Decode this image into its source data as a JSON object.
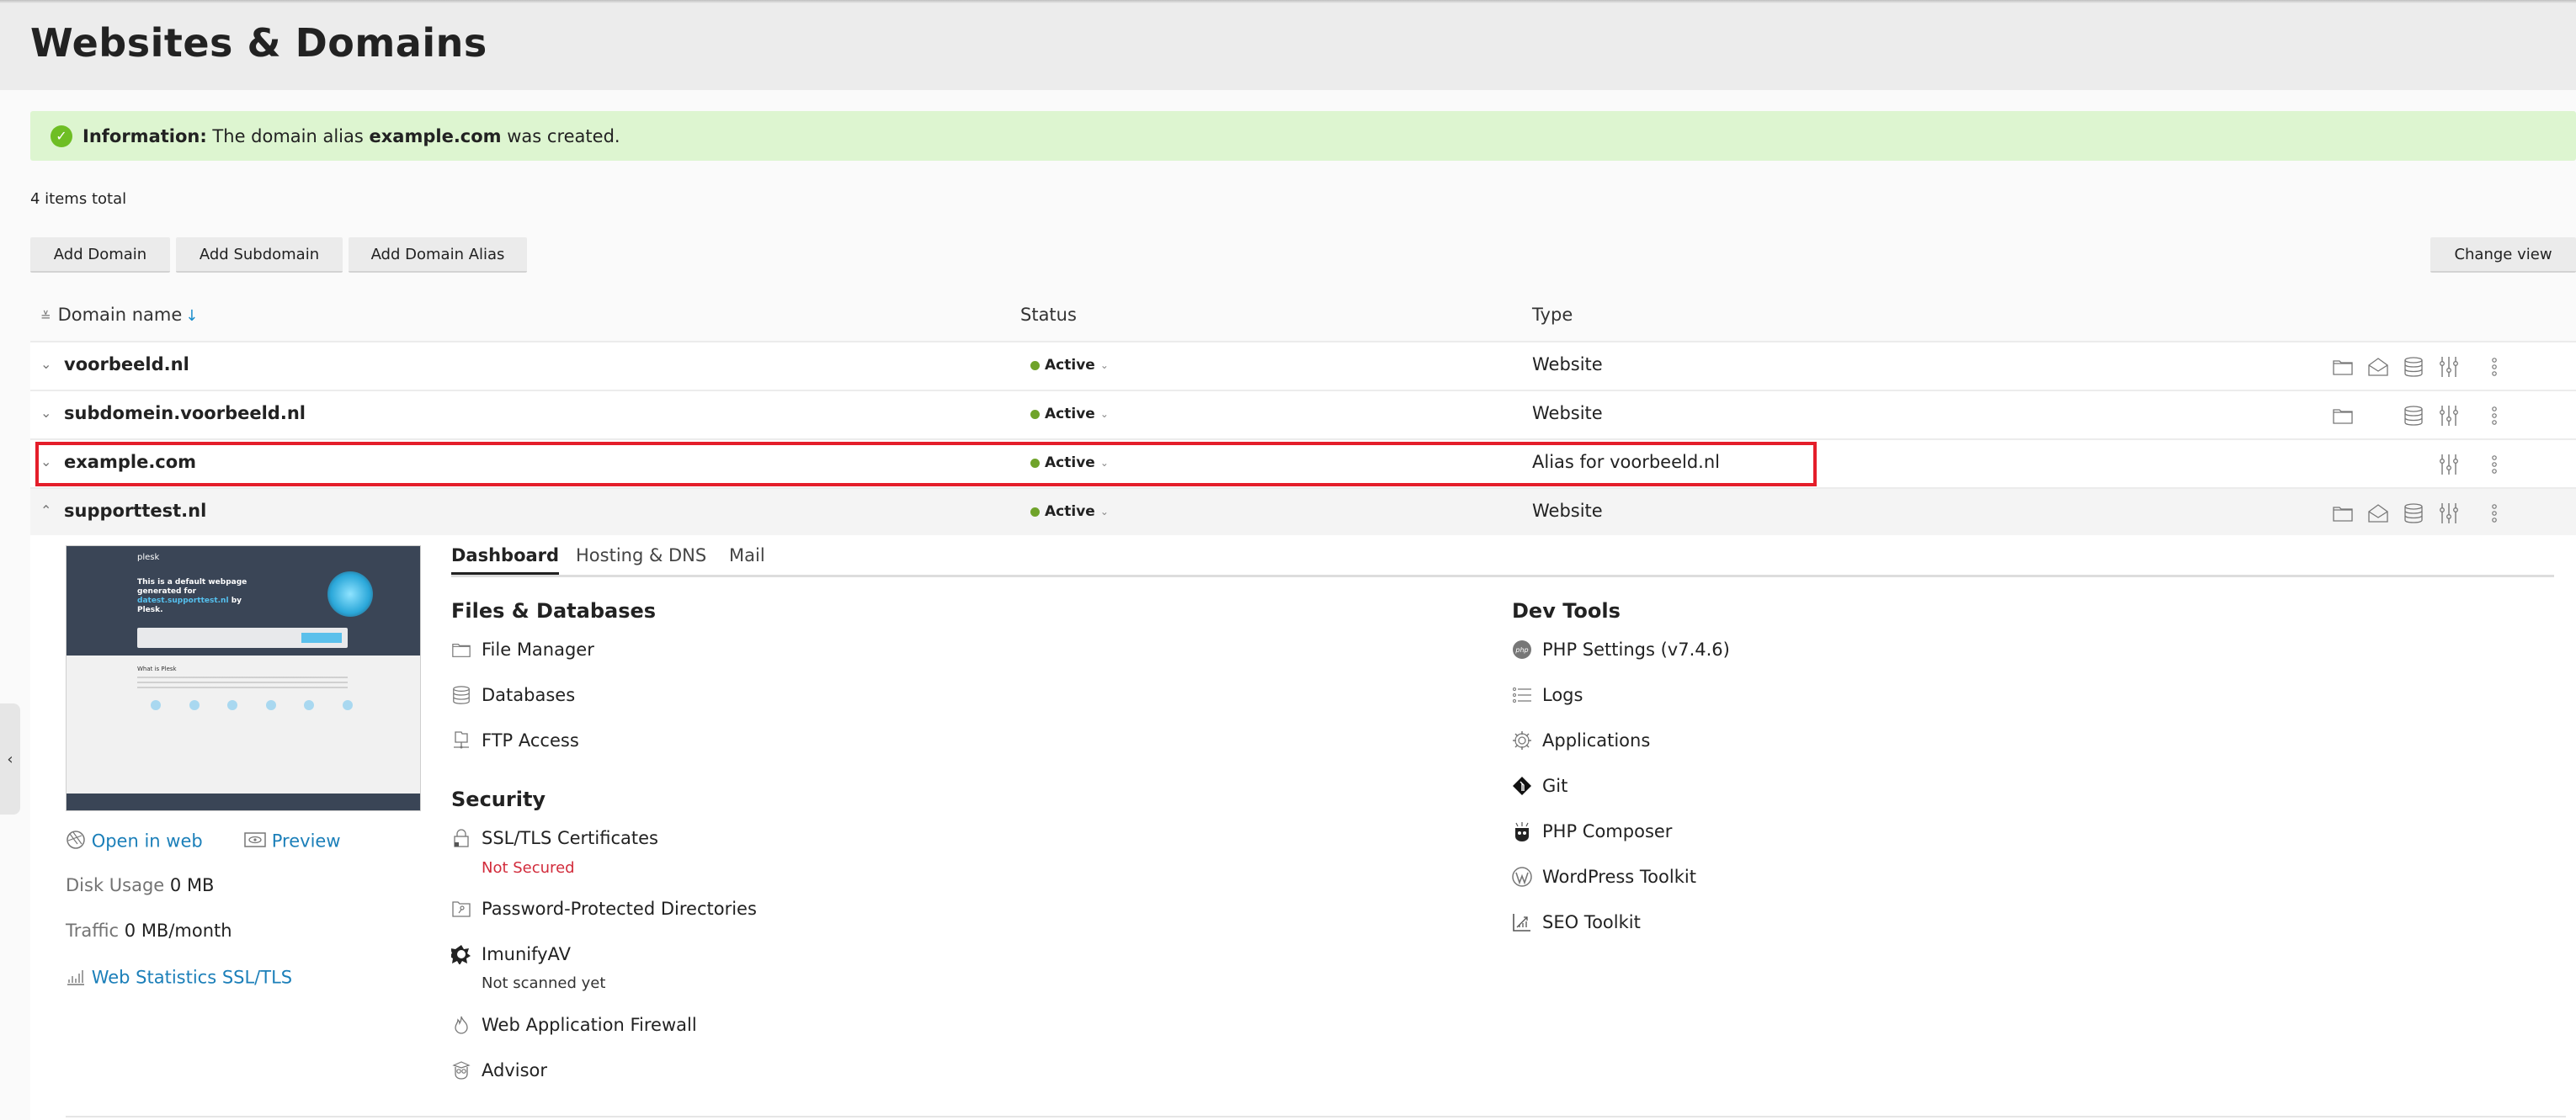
{
  "page": {
    "title": "Websites & Domains"
  },
  "message": {
    "label": "Information:",
    "text_before": " The domain alias ",
    "domain": "example.com",
    "text_after": " was created."
  },
  "items_total": "4 items total",
  "toolbar": {
    "add_domain": "Add Domain",
    "add_subdomain": "Add Subdomain",
    "add_domain_alias": "Add Domain Alias",
    "change_view": "Change view"
  },
  "columns": {
    "domain_name": "Domain name",
    "sort_indicator": "↓",
    "status": "Status",
    "type": "Type"
  },
  "rows": [
    {
      "name": "voorbeeld.nl",
      "status": "Active",
      "type": "Website",
      "expanded": false,
      "actions": [
        "folder",
        "mail",
        "database",
        "settings",
        "more"
      ]
    },
    {
      "name": "subdomein.voorbeeld.nl",
      "status": "Active",
      "type": "Website",
      "expanded": false,
      "actions": [
        "folder",
        "database",
        "settings",
        "more"
      ]
    },
    {
      "name": "example.com",
      "status": "Active",
      "type": "Alias for voorbeeld.nl",
      "expanded": false,
      "highlighted": true,
      "actions": [
        "settings",
        "more"
      ]
    },
    {
      "name": "supporttest.nl",
      "status": "Active",
      "type": "Website",
      "expanded": true,
      "actions": [
        "folder",
        "mail",
        "database",
        "settings",
        "more"
      ]
    }
  ],
  "detail": {
    "thumbnail": {
      "logo": "plesk",
      "headline_a": "This is a default webpage generated for",
      "headline_domain": "datest.supporttest.nl",
      "headline_b": "by Plesk.",
      "section": "What is Plesk"
    },
    "open_in_web": "Open in web",
    "preview": "Preview",
    "disk_usage_label": "Disk Usage",
    "disk_usage_value": "0 MB",
    "traffic_label": "Traffic",
    "traffic_value": "0 MB/month",
    "web_stats": "Web Statistics SSL/TLS",
    "tabs": [
      "Dashboard",
      "Hosting & DNS",
      "Mail"
    ],
    "active_tab": "Dashboard",
    "files_db": {
      "title": "Files & Databases",
      "items": [
        "File Manager",
        "Databases",
        "FTP Access"
      ]
    },
    "security": {
      "title": "Security",
      "ssl": "SSL/TLS Certificates",
      "ssl_status": "Not Secured",
      "ppd": "Password-Protected Directories",
      "imunify": "ImunifyAV",
      "imunify_status": "Not scanned yet",
      "waf": "Web Application Firewall",
      "advisor": "Advisor"
    },
    "dev_tools": {
      "title": "Dev Tools",
      "items": [
        "PHP Settings (v7.4.6)",
        "Logs",
        "Applications",
        "Git",
        "PHP Composer",
        "WordPress Toolkit",
        "SEO Toolkit"
      ]
    }
  },
  "colors": {
    "accent_link": "#1b7fb9",
    "success_bg": "#ddf5d0",
    "active_dot": "#6fa32a",
    "highlight": "#e41e2a",
    "error_text": "#d22b3b"
  }
}
